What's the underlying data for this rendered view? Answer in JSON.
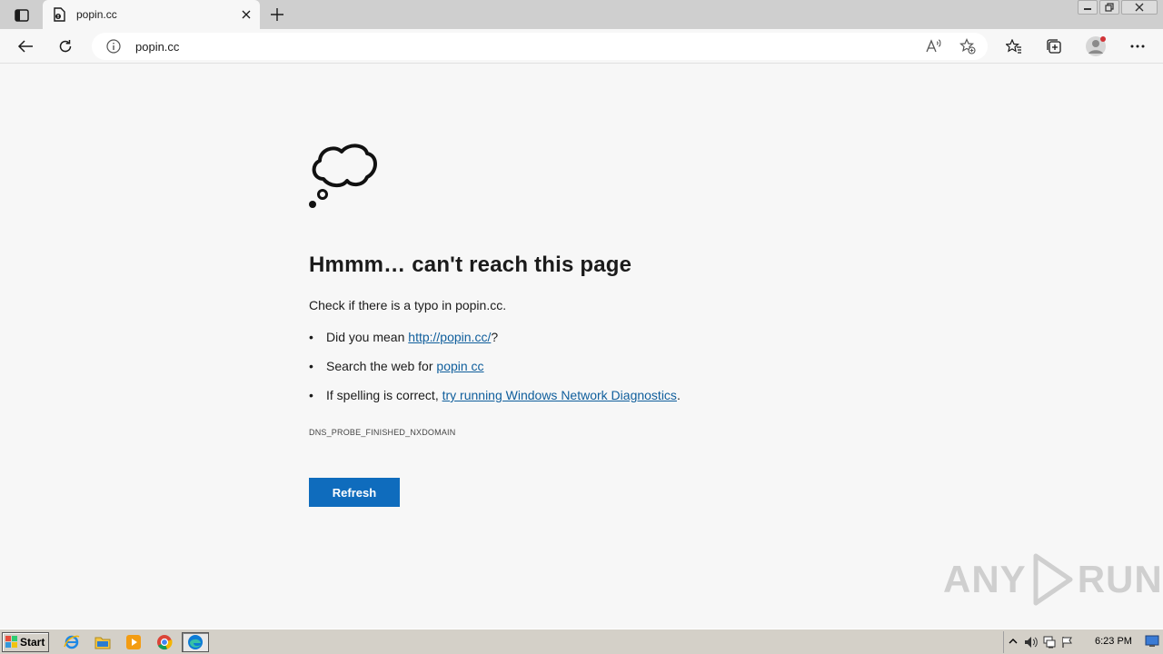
{
  "browser": {
    "tab": {
      "title": "popin.cc"
    },
    "address": {
      "url": "popin.cc"
    }
  },
  "error_page": {
    "heading": "Hmmm… can't reach this page",
    "lead": "Check if there is a typo in popin.cc.",
    "suggestion_1": {
      "prefix": "Did you mean ",
      "link": "http://popin.cc/",
      "suffix": "?"
    },
    "suggestion_2": {
      "prefix": "Search the web for ",
      "link": "popin cc",
      "suffix": ""
    },
    "suggestion_3": {
      "prefix": "If spelling is correct, ",
      "link": "try running Windows Network Diagnostics",
      "suffix": "."
    },
    "error_code": "DNS_PROBE_FINISHED_NXDOMAIN",
    "refresh_label": "Refresh"
  },
  "watermark": {
    "left": "ANY",
    "right": "RUN"
  },
  "taskbar": {
    "start_label": "Start",
    "clock": "6:23 PM"
  },
  "colors": {
    "accent": "#0f6cbd",
    "link": "#0f5e9c",
    "page_bg": "#f7f7f7"
  }
}
